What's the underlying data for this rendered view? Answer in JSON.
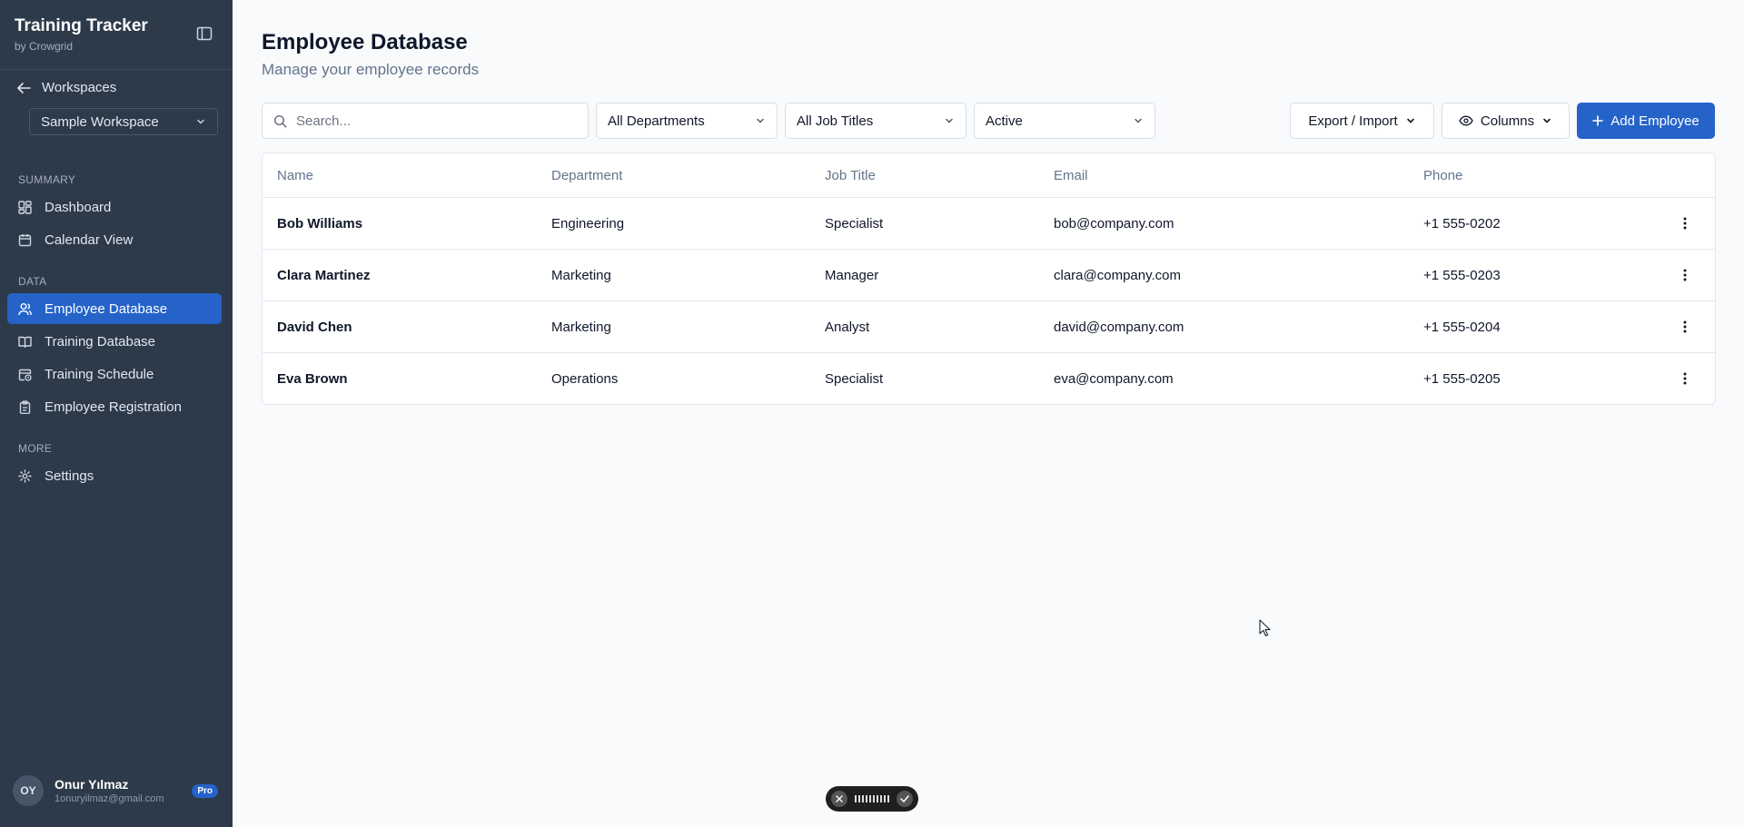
{
  "app": {
    "title": "Training Tracker",
    "subtitle": "by Crowgrid"
  },
  "sidebar": {
    "back_label": "Workspaces",
    "workspace": "Sample Workspace",
    "sections": {
      "summary": "SUMMARY",
      "data": "DATA",
      "more": "MORE"
    },
    "items": {
      "dashboard": "Dashboard",
      "calendar": "Calendar View",
      "employee_db": "Employee Database",
      "training_db": "Training Database",
      "training_schedule": "Training Schedule",
      "employee_registration": "Employee Registration",
      "settings": "Settings"
    },
    "active_item": "employee_db",
    "user": {
      "initials": "OY",
      "name": "Onur Yılmaz",
      "email": "1onuryilmaz@gmail.com",
      "badge": "Pro"
    }
  },
  "page": {
    "title": "Employee Database",
    "subtitle": "Manage your employee records"
  },
  "toolbar": {
    "search_placeholder": "Search...",
    "department_filter": "All Departments",
    "job_title_filter": "All Job Titles",
    "status_filter": "Active",
    "export_label": "Export / Import",
    "columns_label": "Columns",
    "add_label": "Add Employee"
  },
  "table": {
    "columns": [
      "Name",
      "Department",
      "Job Title",
      "Email",
      "Phone"
    ],
    "rows": [
      [
        "Bob Williams",
        "Engineering",
        "Specialist",
        "bob@company.com",
        "+1 555-0202"
      ],
      [
        "Clara Martinez",
        "Marketing",
        "Manager",
        "clara@company.com",
        "+1 555-0203"
      ],
      [
        "David Chen",
        "Marketing",
        "Analyst",
        "david@company.com",
        "+1 555-0204"
      ],
      [
        "Eva Brown",
        "Operations",
        "Specialist",
        "eva@company.com",
        "+1 555-0205"
      ]
    ]
  },
  "colors": {
    "sidebar_bg": "#2d3a4a",
    "accent": "#2563c9",
    "page_bg": "#f8fafc"
  }
}
